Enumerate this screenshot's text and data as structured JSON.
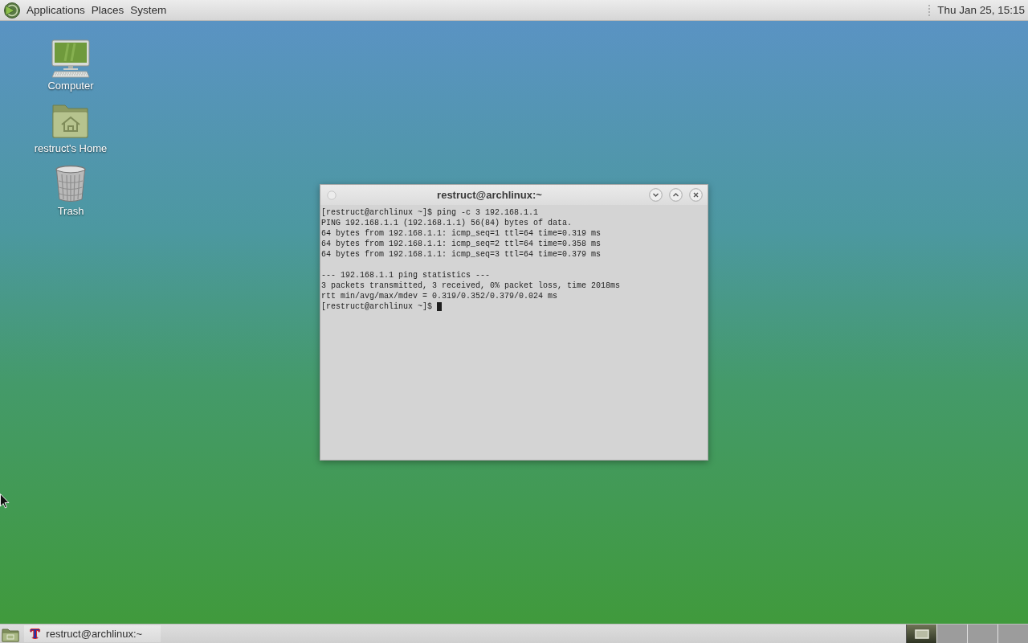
{
  "top_panel": {
    "menus": [
      {
        "label": "Applications"
      },
      {
        "label": "Places"
      },
      {
        "label": "System"
      }
    ],
    "clock": "Thu Jan 25, 15:15"
  },
  "desktop_icons": [
    {
      "kind": "computer",
      "label": "Computer"
    },
    {
      "kind": "home",
      "label": "restruct's Home"
    },
    {
      "kind": "trash",
      "label": "Trash"
    }
  ],
  "terminal_window": {
    "title": "restruct@archlinux:~",
    "output_blocks": [
      {
        "lines": [
          "[restruct@archlinux ~]$ ping -c 3 192.168.1.1",
          "PING 192.168.1.1 (192.168.1.1) 56(84) bytes of data.",
          "64 bytes from 192.168.1.1: icmp_seq=1 ttl=64 time=0.319 ms",
          "64 bytes from 192.168.1.1: icmp_seq=2 ttl=64 time=0.358 ms",
          "64 bytes from 192.168.1.1: icmp_seq=3 ttl=64 time=0.379 ms"
        ]
      },
      {
        "lines": [
          "--- 192.168.1.1 ping statistics ---",
          "3 packets transmitted, 3 received, 0% packet loss, time 2018ms",
          "rtt min/avg/max/mdev = 0.319/0.352/0.379/0.024 ms"
        ]
      }
    ],
    "prompt": "[restruct@archlinux ~]$"
  },
  "bottom_panel": {
    "tasks": [
      {
        "icon": "T",
        "label": "restruct@archlinux:~"
      }
    ],
    "workspaces": [
      {
        "selected": true,
        "has_window": true
      },
      {
        "selected": false,
        "has_window": false
      },
      {
        "selected": false,
        "has_window": false
      },
      {
        "selected": false,
        "has_window": false
      }
    ]
  }
}
